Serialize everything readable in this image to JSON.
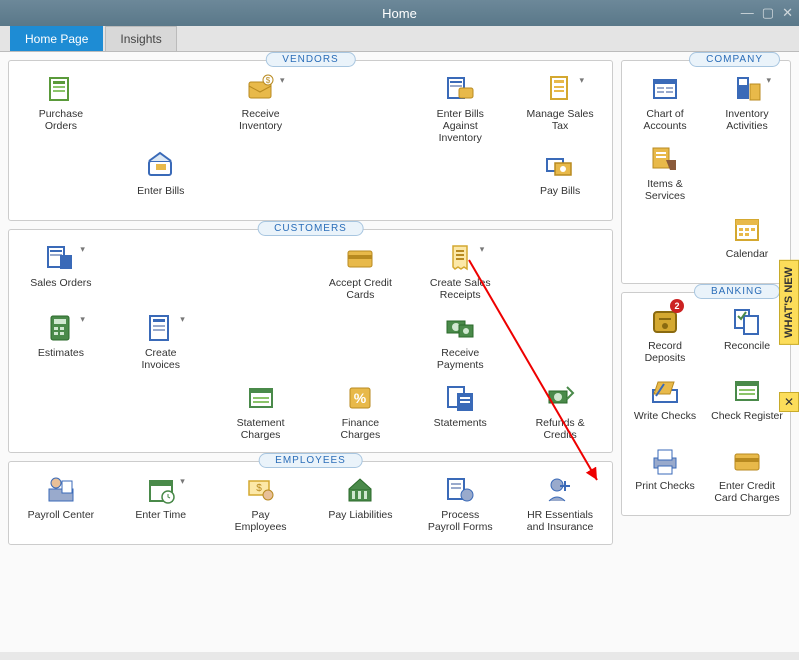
{
  "window": {
    "title": "Home"
  },
  "tabs": {
    "home": "Home Page",
    "insights": "Insights"
  },
  "vendors": {
    "title": "VENDORS",
    "purchase_orders": "Purchase Orders",
    "receive_inventory": "Receive Inventory",
    "enter_bills_against": "Enter Bills Against Inventory",
    "manage_sales_tax": "Manage Sales Tax",
    "enter_bills": "Enter Bills",
    "pay_bills": "Pay Bills"
  },
  "customers": {
    "title": "CUSTOMERS",
    "sales_orders": "Sales Orders",
    "accept_cc": "Accept Credit Cards",
    "create_sales_receipts": "Create Sales Receipts",
    "estimates": "Estimates",
    "create_invoices": "Create Invoices",
    "receive_payments": "Receive Payments",
    "statement_charges": "Statement Charges",
    "finance_charges": "Finance Charges",
    "statements": "Statements",
    "refunds_credits": "Refunds & Credits"
  },
  "employees": {
    "title": "EMPLOYEES",
    "payroll_center": "Payroll Center",
    "enter_time": "Enter Time",
    "pay_employees": "Pay Employees",
    "pay_liabilities": "Pay Liabilities",
    "process_payroll_forms": "Process Payroll Forms",
    "hr_essentials": "HR Essentials and Insurance"
  },
  "company": {
    "title": "COMPANY",
    "chart_of_accounts": "Chart of Accounts",
    "inventory_activities": "Inventory Activities",
    "items_services": "Items & Services",
    "calendar": "Calendar"
  },
  "banking": {
    "title": "BANKING",
    "record_deposits": "Record Deposits",
    "record_deposits_badge": "2",
    "reconcile": "Reconcile",
    "write_checks": "Write Checks",
    "check_register": "Check Register",
    "print_checks": "Print Checks",
    "enter_cc_charges": "Enter Credit Card Charges"
  },
  "whatsnew": {
    "label": "WHAT'S NEW",
    "close": "✕"
  }
}
